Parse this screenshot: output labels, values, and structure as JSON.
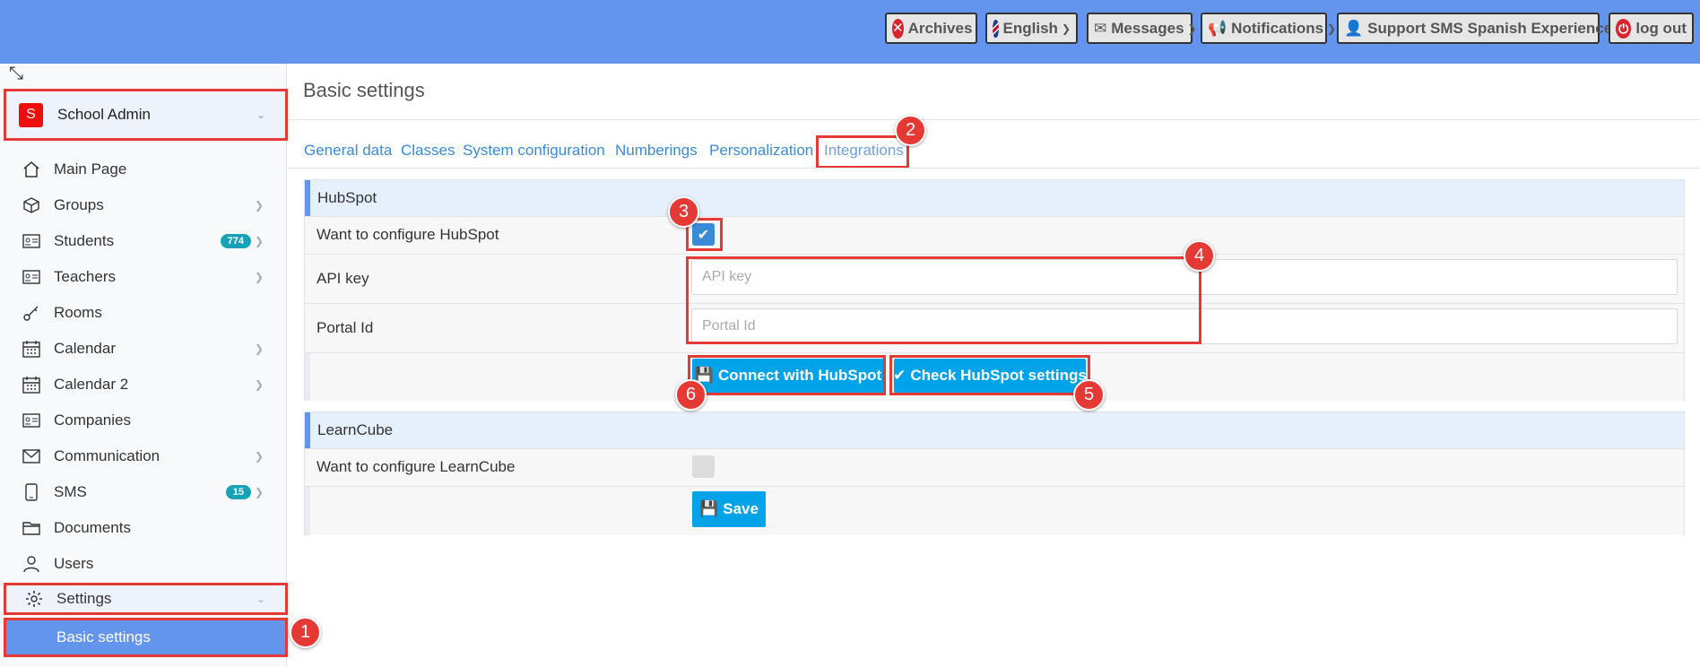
{
  "topbar": {
    "archives": "Archives",
    "language": "English",
    "messages": "Messages",
    "notifications": "Notifications",
    "user": "Support SMS Spanish Experience",
    "logout": "log out"
  },
  "sidebar": {
    "school_initial": "S",
    "school_name": "School Admin",
    "items": [
      {
        "label": "Main Page",
        "icon": "home-icon"
      },
      {
        "label": "Groups",
        "icon": "cube-icon"
      },
      {
        "label": "Students",
        "icon": "id-card-icon",
        "badge": "774"
      },
      {
        "label": "Teachers",
        "icon": "id-card-icon"
      },
      {
        "label": "Rooms",
        "icon": "key-icon"
      },
      {
        "label": "Calendar",
        "icon": "calendar-icon"
      },
      {
        "label": "Calendar 2",
        "icon": "calendar-icon"
      },
      {
        "label": "Companies",
        "icon": "id-card-icon"
      },
      {
        "label": "Communication",
        "icon": "envelope-icon"
      },
      {
        "label": "SMS",
        "icon": "phone-icon",
        "badge": "15"
      },
      {
        "label": "Documents",
        "icon": "folder-icon"
      },
      {
        "label": "Users",
        "icon": "user-icon"
      },
      {
        "label": "Settings",
        "icon": "gear-icon"
      }
    ],
    "basic_settings": "Basic settings"
  },
  "main": {
    "title": "Basic settings",
    "tabs": [
      "General data",
      "Classes",
      "System configuration",
      "Numberings",
      "Personalization",
      "Integrations"
    ],
    "hubspot": {
      "header": "HubSpot",
      "configure_label": "Want to configure HubSpot",
      "api_key_label": "API key",
      "api_key_placeholder": "API key",
      "portal_label": "Portal Id",
      "portal_placeholder": "Portal Id",
      "connect_button": "Connect with HubSpot",
      "check_button": "Check HubSpot settings"
    },
    "learncube": {
      "header": "LearnCube",
      "configure_label": "Want to configure LearnCube",
      "save_button": "Save"
    }
  },
  "callouts": [
    "1",
    "2",
    "3",
    "4",
    "5",
    "6"
  ],
  "colors": {
    "topbar": "#6495ed",
    "accent_red": "#e53935",
    "button_blue": "#00a2e8",
    "link_blue": "#3a8ad8"
  }
}
